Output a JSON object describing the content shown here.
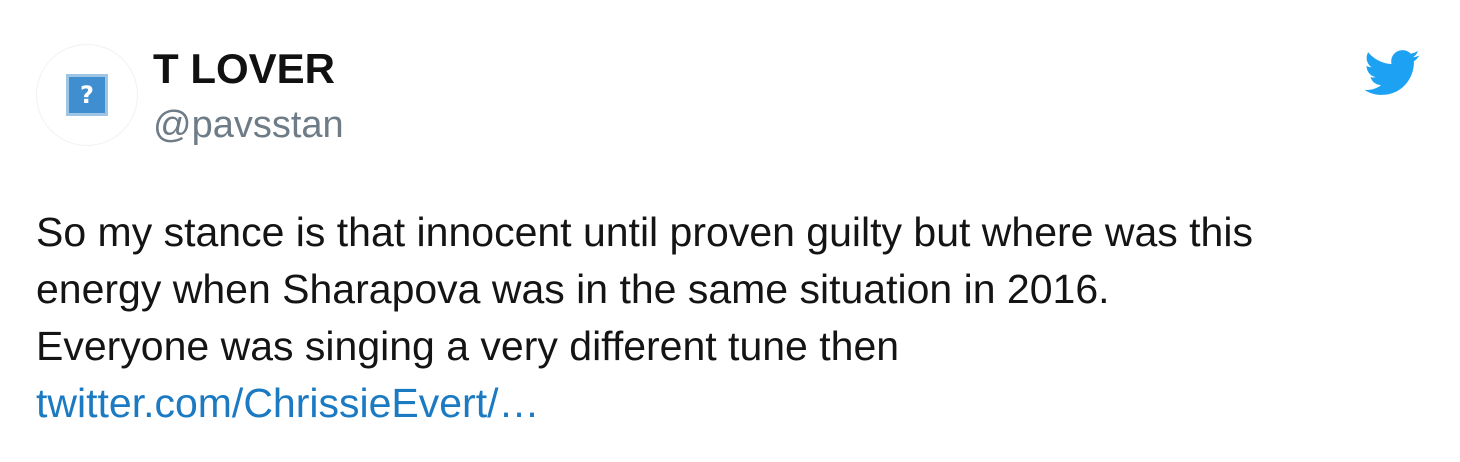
{
  "tweet": {
    "display_name": "T LOVER",
    "handle": "@pavsstan",
    "avatar_icon": "broken-image-icon",
    "avatar_glyph": "?",
    "logo_icon": "twitter-bird-icon",
    "text_lines": [
      "So my stance is that innocent until proven guilty but where was this",
      "energy when Sharapova was in the same situation in 2016.",
      "Everyone was singing a very different tune then"
    ],
    "link_text": "twitter.com/ChrissieEvert/…"
  },
  "colors": {
    "brand_blue": "#1da1f2",
    "link": "#1b7ac2",
    "handle_gray": "#6e7c87",
    "text": "#141414"
  }
}
